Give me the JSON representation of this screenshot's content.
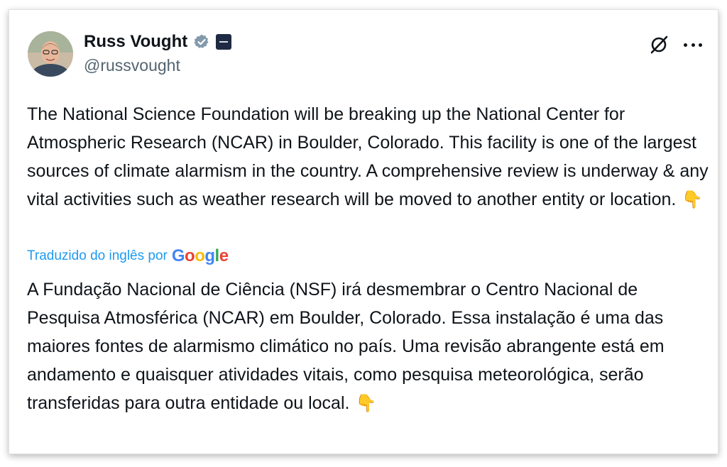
{
  "author": {
    "name": "Russ Vought",
    "handle": "@russvought"
  },
  "icons": {
    "verified": "verified-badge-icon",
    "affiliation": "affiliation-badge-icon",
    "grok": "grok-icon",
    "more": "more-options-icon",
    "emoji": "backhand-index-pointing-down"
  },
  "tweet": {
    "text": "The National Science Foundation will be breaking up the National Center for Atmospheric Research (NCAR) in Boulder, Colorado. This facility is one of the largest sources of climate alarmism in the country. A comprehensive review is underway & any vital activities such as weather research will be moved to another entity or location.",
    "emoji": "👇"
  },
  "translation": {
    "label": "Traduzido do inglês por",
    "provider_letters": [
      "G",
      "o",
      "o",
      "g",
      "l",
      "e"
    ],
    "text": "A Fundação Nacional de Ciência (NSF) irá desmembrar o Centro Nacional de Pesquisa Atmosférica (NCAR) em Boulder, Colorado. Essa instalação é uma das maiores fontes de alarmismo climático no país. Uma revisão abrangente está em andamento e quaisquer atividades vitais, como pesquisa meteorológica, serão transferidas para outra entidade ou local.",
    "emoji": "👇"
  },
  "colors": {
    "text": "#0f1419",
    "secondary": "#536471",
    "link": "#1d9bf0",
    "verified": "#829aab"
  }
}
